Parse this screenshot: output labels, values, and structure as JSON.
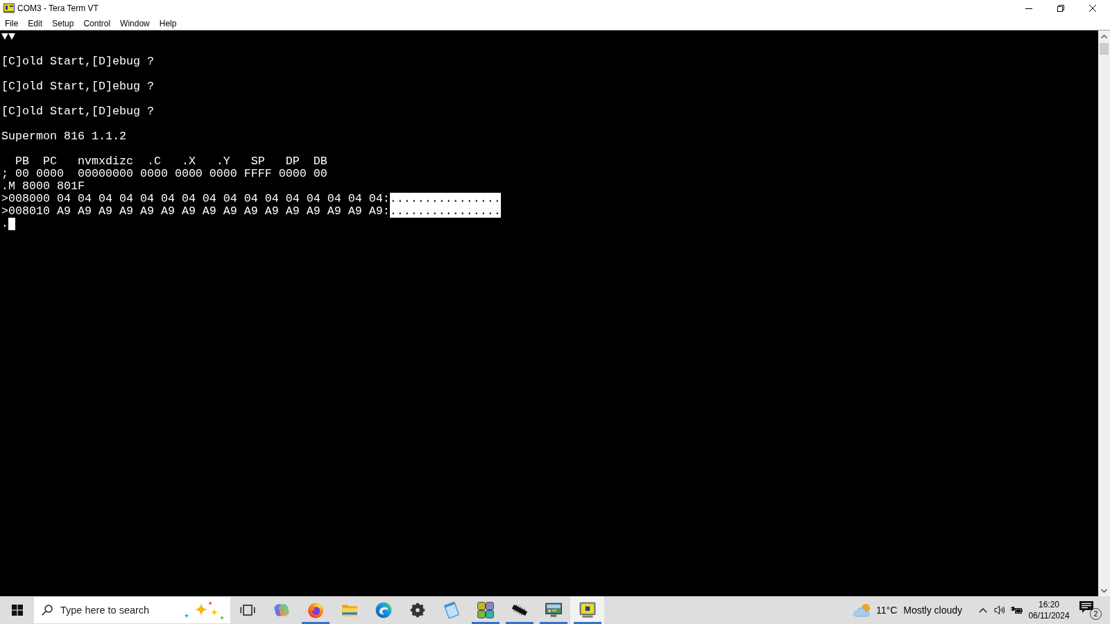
{
  "window": {
    "title": "COM3 - Tera Term VT"
  },
  "menu": [
    "File",
    "Edit",
    "Setup",
    "Control",
    "Window",
    "Help"
  ],
  "terminal": {
    "lines": [
      {
        "kind": "text",
        "segments": [
          {
            "kind": "text",
            "text": "▼▼",
            "inverse": false
          }
        ]
      },
      {
        "kind": "blank"
      },
      {
        "kind": "text",
        "segments": [
          {
            "kind": "text",
            "text": "[C]old Start,[D]ebug ?",
            "inverse": false
          }
        ]
      },
      {
        "kind": "blank"
      },
      {
        "kind": "text",
        "segments": [
          {
            "kind": "text",
            "text": "[C]old Start,[D]ebug ?",
            "inverse": false
          }
        ]
      },
      {
        "kind": "blank"
      },
      {
        "kind": "text",
        "segments": [
          {
            "kind": "text",
            "text": "[C]old Start,[D]ebug ?",
            "inverse": false
          }
        ]
      },
      {
        "kind": "blank"
      },
      {
        "kind": "text",
        "segments": [
          {
            "kind": "text",
            "text": "Supermon 816 1.1.2",
            "inverse": false
          }
        ]
      },
      {
        "kind": "blank"
      },
      {
        "kind": "text",
        "segments": [
          {
            "kind": "text",
            "text": "  PB  PC   nvmxdizc  .C   .X   .Y   SP   DP  DB",
            "inverse": false
          }
        ]
      },
      {
        "kind": "text",
        "segments": [
          {
            "kind": "text",
            "text": "; 00 0000  00000000 0000 0000 0000 FFFF 0000 00",
            "inverse": false
          }
        ]
      },
      {
        "kind": "text",
        "segments": [
          {
            "kind": "text",
            "text": ".M 8000 801F",
            "inverse": false
          }
        ]
      },
      {
        "kind": "text",
        "segments": [
          {
            "kind": "text",
            "text": ">008000 04 04 04 04 04 04 04 04 04 04 04 04 04 04 04 04:",
            "inverse": false
          },
          {
            "kind": "text",
            "text": "................",
            "inverse": true
          }
        ]
      },
      {
        "kind": "text",
        "segments": [
          {
            "kind": "text",
            "text": ">008010 A9 A9 A9 A9 A9 A9 A9 A9 A9 A9 A9 A9 A9 A9 A9 A9:",
            "inverse": false
          },
          {
            "kind": "text",
            "text": "................",
            "inverse": true
          }
        ]
      },
      {
        "kind": "text",
        "segments": [
          {
            "kind": "text",
            "text": ".",
            "inverse": false
          },
          {
            "kind": "cursor"
          }
        ]
      }
    ]
  },
  "taskbar": {
    "search": {
      "placeholder": "Type here to search"
    },
    "apps": [
      {
        "kind": "taskview",
        "running": false,
        "selected": false
      },
      {
        "kind": "orb",
        "running": false,
        "selected": false
      },
      {
        "kind": "fox",
        "running": true,
        "selected": false
      },
      {
        "kind": "folder",
        "running": false,
        "selected": false
      },
      {
        "kind": "wave",
        "running": false,
        "selected": false
      },
      {
        "kind": "gear",
        "running": false,
        "selected": false
      },
      {
        "kind": "sheet",
        "running": false,
        "selected": false
      },
      {
        "kind": "tiles",
        "running": true,
        "selected": false
      },
      {
        "kind": "chip",
        "running": true,
        "selected": false
      },
      {
        "kind": "board",
        "running": true,
        "selected": false
      },
      {
        "kind": "terminal",
        "running": true,
        "selected": true
      }
    ],
    "weather": {
      "temperature": "11°C",
      "condition": "Mostly cloudy"
    },
    "clock": {
      "time": "16:20",
      "date": "06/11/2024"
    },
    "notifications": {
      "count": "2"
    }
  }
}
